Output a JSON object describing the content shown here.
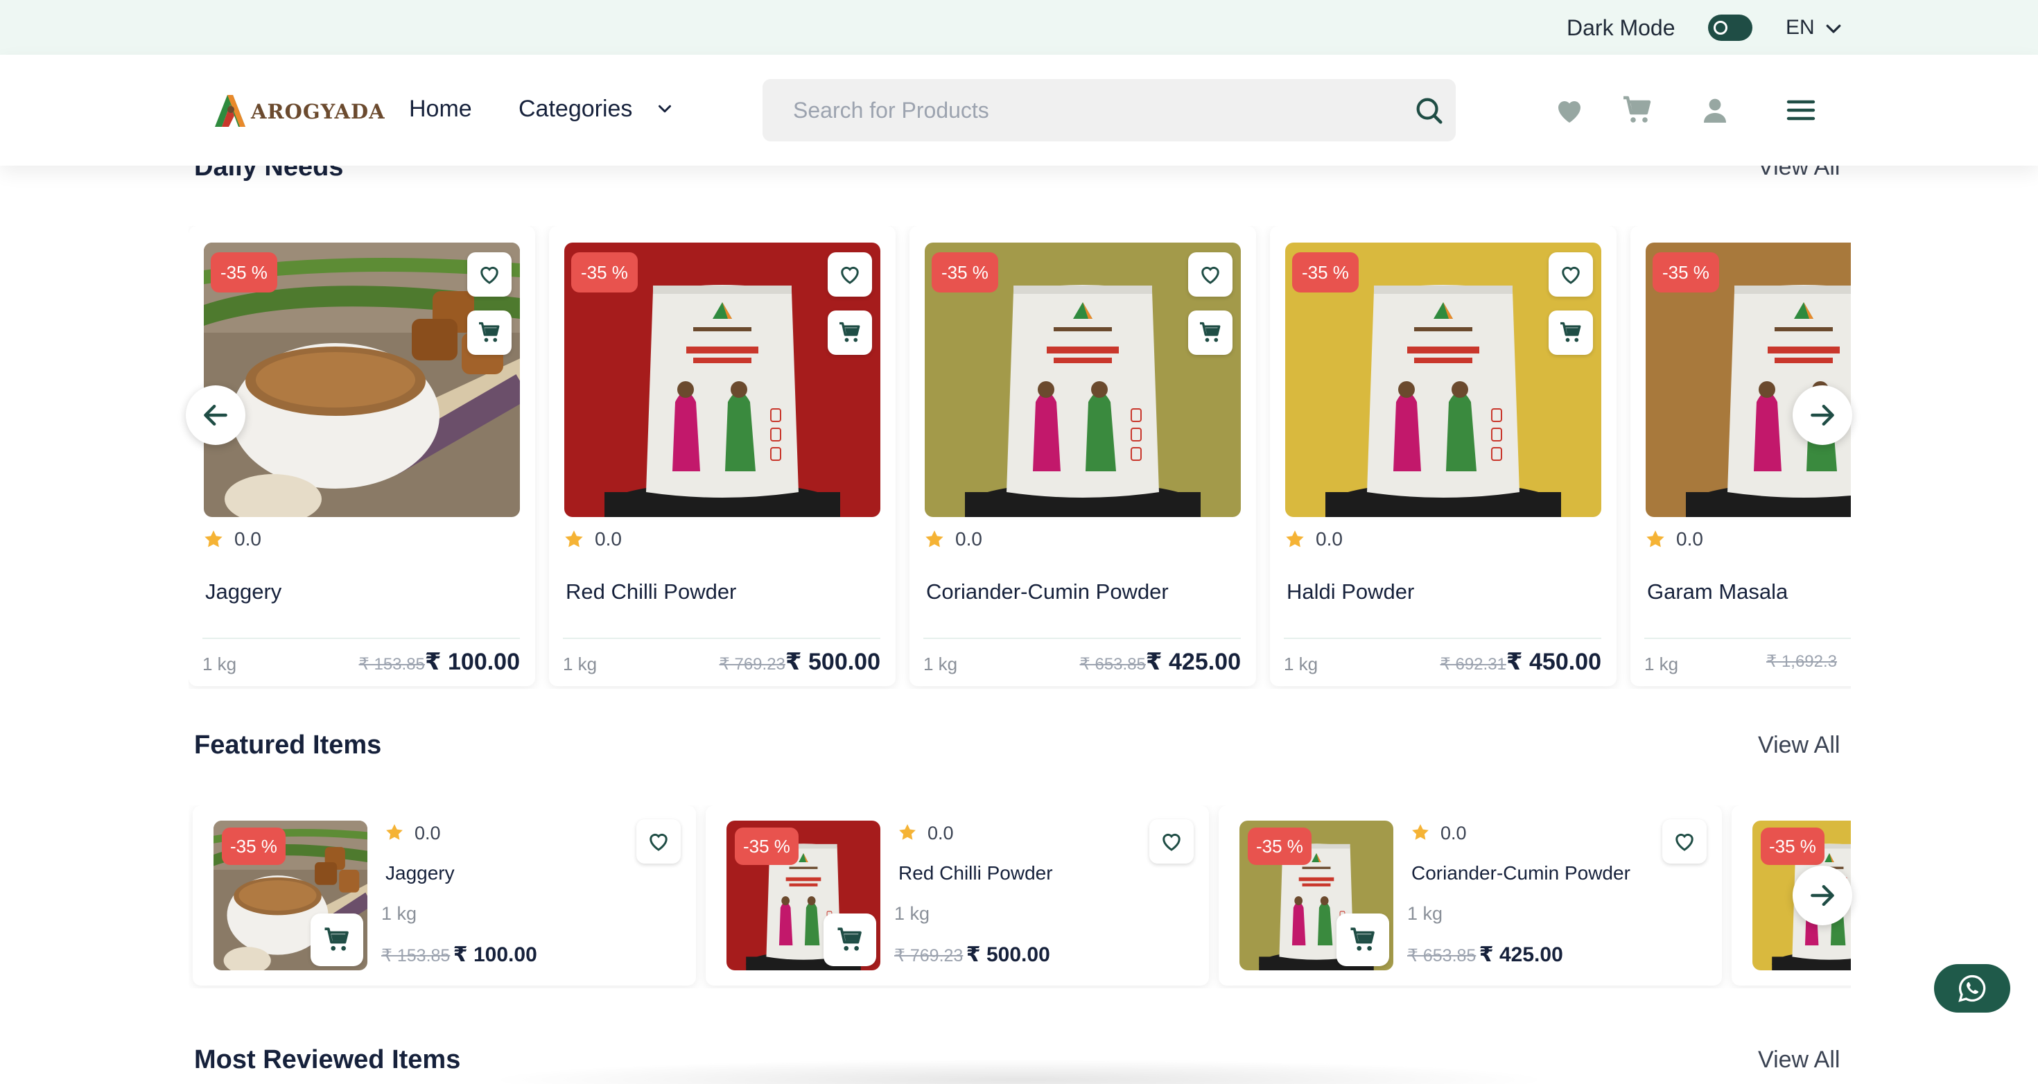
{
  "topbar": {
    "dark_mode_label": "Dark Mode",
    "dark_mode_on": true,
    "language": "EN"
  },
  "header": {
    "logo_text": "AROGYADA",
    "nav": {
      "home": "Home",
      "categories": "Categories"
    },
    "search": {
      "placeholder": "Search for Products",
      "value": ""
    },
    "icons": [
      "heart-icon",
      "cart-icon",
      "user-icon",
      "menu-icon"
    ]
  },
  "daily_needs": {
    "title": "Daily Needs",
    "view_all": "View All",
    "items": [
      {
        "badge": "-35 %",
        "rating": "0.0",
        "name": "Jaggery",
        "unit": "1 kg",
        "old_price": "₹ 153.85",
        "price": "₹ 100.00",
        "bg": "#7a6a55"
      },
      {
        "badge": "-35 %",
        "rating": "0.0",
        "name": "Red Chilli Powder",
        "unit": "1 kg",
        "old_price": "₹ 769.23",
        "price": "₹ 500.00",
        "bg": "#a61c1c"
      },
      {
        "badge": "-35 %",
        "rating": "0.0",
        "name": "Coriander-Cumin Powder",
        "unit": "1 kg",
        "old_price": "₹ 653.85",
        "price": "₹ 425.00",
        "bg": "#a39a4a"
      },
      {
        "badge": "-35 %",
        "rating": "0.0",
        "name": "Haldi Powder",
        "unit": "1 kg",
        "old_price": "₹ 692.31",
        "price": "₹ 450.00",
        "bg": "#d9b93e"
      },
      {
        "badge": "-35 %",
        "rating": "0.0",
        "name": "Garam Masala",
        "unit": "1 kg",
        "old_price": "₹ 1,692.3",
        "price": "",
        "bg": "#a8793c"
      }
    ]
  },
  "featured": {
    "title": "Featured Items",
    "view_all": "View All",
    "items": [
      {
        "badge": "-35 %",
        "rating": "0.0",
        "name": "Jaggery",
        "unit": "1 kg",
        "old_price": "₹ 153.85",
        "price": "₹ 100.00",
        "bg": "#7a6a55"
      },
      {
        "badge": "-35 %",
        "rating": "0.0",
        "name": "Red Chilli Powder",
        "unit": "1 kg",
        "old_price": "₹ 769.23",
        "price": "₹ 500.00",
        "bg": "#a61c1c"
      },
      {
        "badge": "-35 %",
        "rating": "0.0",
        "name": "Coriander-Cumin Powder",
        "unit": "1 kg",
        "old_price": "₹ 653.85",
        "price": "₹ 425.00",
        "bg": "#a39a4a"
      },
      {
        "badge": "-35 %",
        "bg": "#d9b93e"
      }
    ]
  },
  "most_reviewed": {
    "title": "Most Reviewed Items",
    "view_all": "View All"
  },
  "colors": {
    "accent": "#1f4d45",
    "discount": "#e8534e",
    "topbar_bg": "#eef7f3",
    "star": "#f5b335"
  }
}
